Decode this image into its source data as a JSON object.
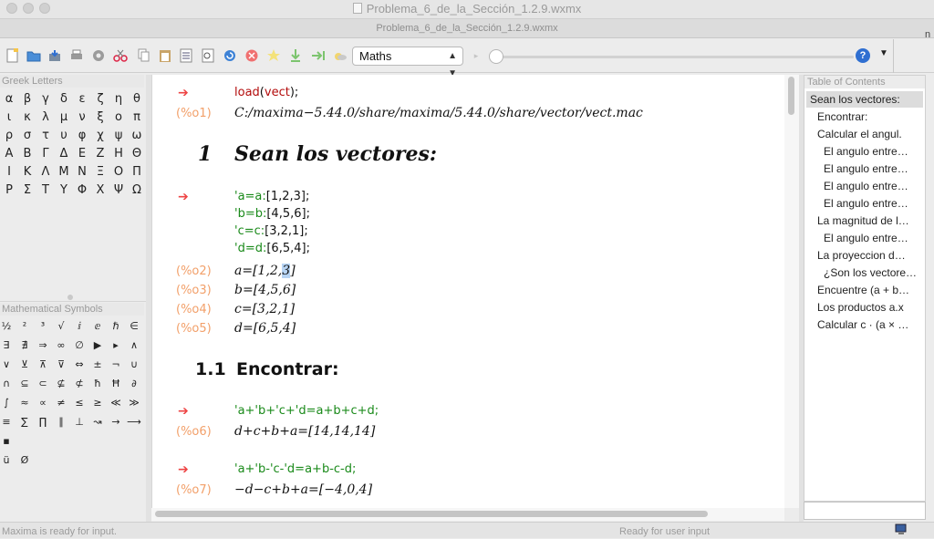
{
  "window": {
    "title": "Problema_6_de_la_Sección_1.2.9.wxmx",
    "tab_title": "Problema_6_de_la_Sección_1.2.9.wxmx",
    "edge_letter": "n"
  },
  "toolbar": {
    "icons": [
      "new-file-icon",
      "open-folder-icon",
      "save-icon",
      "print-icon",
      "settings-icon",
      "cut-icon",
      "copy-icon",
      "paste-icon",
      "select-all-icon",
      "find-icon",
      "refresh-icon",
      "stop-icon",
      "star-icon",
      "download-icon",
      "step-icon",
      "cloud-icon"
    ],
    "mode_select": "Maths",
    "help_label": "?"
  },
  "greek_panel": {
    "title": "Greek Letters",
    "rows": [
      [
        "α",
        "β",
        "γ",
        "δ",
        "ε",
        "ζ",
        "η",
        "θ"
      ],
      [
        "ι",
        "κ",
        "λ",
        "μ",
        "ν",
        "ξ",
        "ο",
        "π"
      ],
      [
        "ρ",
        "σ",
        "τ",
        "υ",
        "φ",
        "χ",
        "ψ",
        "ω"
      ],
      [
        "Α",
        "Β",
        "Γ",
        "Δ",
        "Ε",
        "Ζ",
        "Η",
        "Θ"
      ],
      [
        "Ι",
        "Κ",
        "Λ",
        "Μ",
        "Ν",
        "Ξ",
        "Ο",
        "Π"
      ],
      [
        "Ρ",
        "Σ",
        "Τ",
        "Υ",
        "Φ",
        "Χ",
        "Ψ",
        "Ω"
      ]
    ]
  },
  "symbols_panel": {
    "title": "Mathematical Symbols",
    "rows": [
      [
        "½",
        "²",
        "³",
        "√",
        "ⅈ",
        "ⅇ",
        "ℏ",
        "∈"
      ],
      [
        "∃",
        "∄",
        "⇒",
        "∞",
        "∅",
        "▶",
        "▸",
        "∧"
      ],
      [
        "∨",
        "⊻",
        "⊼",
        "⊽",
        "⇔",
        "±",
        "¬",
        "∪"
      ],
      [
        "∩",
        "⊆",
        "⊂",
        "⊈",
        "⊄",
        "ħ",
        "Ħ",
        "∂"
      ],
      [
        "∫",
        "≈",
        "∝",
        "≠",
        "≤",
        "≥",
        "≪",
        "≫"
      ],
      [
        "≡",
        "∑",
        "∏",
        "∥",
        "⊥",
        "↝",
        "→",
        "⟶"
      ],
      [
        "▪"
      ],
      [
        "ü",
        "Ø"
      ]
    ]
  },
  "document": {
    "cells": [
      {
        "type": "input",
        "segments": [
          {
            "t": "load",
            "c": "fn"
          },
          {
            "t": "(",
            "c": "txt"
          },
          {
            "t": "vect",
            "c": "fn"
          },
          {
            "t": ");",
            "c": "txt"
          }
        ]
      },
      {
        "type": "output",
        "label": "(%o1)",
        "text": "C:/maxima−5.44.0/share/maxima/5.44.0/share/vector/vect.mac"
      },
      {
        "type": "section",
        "number": "1",
        "title": "Sean los vectores:"
      },
      {
        "type": "input_multi",
        "lines": [
          [
            {
              "t": "'a=a:",
              "c": "var"
            },
            {
              "t": "[1,2,3];",
              "c": "txt"
            }
          ],
          [
            {
              "t": "'b=b:",
              "c": "var"
            },
            {
              "t": "[4,5,6];",
              "c": "txt"
            }
          ],
          [
            {
              "t": "'c=c:",
              "c": "var"
            },
            {
              "t": "[3,2,1];",
              "c": "txt"
            }
          ],
          [
            {
              "t": "'d=d:",
              "c": "var"
            },
            {
              "t": "[6,5,4];",
              "c": "txt"
            }
          ]
        ]
      },
      {
        "type": "output",
        "label": "(%o2)",
        "text": "a=[1,2,",
        "highlight": "3",
        "after": "]"
      },
      {
        "type": "output",
        "label": "(%o3)",
        "text": "b=[4,5,6]"
      },
      {
        "type": "output",
        "label": "(%o4)",
        "text": "c=[3,2,1]"
      },
      {
        "type": "output",
        "label": "(%o5)",
        "text": "d=[6,5,4]"
      },
      {
        "type": "subsection",
        "number": "1.1",
        "title": "Encontrar:"
      },
      {
        "type": "input",
        "segments": [
          {
            "t": "'a+'b+'c+'d=a+b+c+d;",
            "c": "var"
          }
        ]
      },
      {
        "type": "output",
        "label": "(%o6)",
        "text": "d+c+b+a=[14,14,14]"
      },
      {
        "type": "input",
        "segments": [
          {
            "t": "'a+'b-'c-'d=a+b-c-d;",
            "c": "var"
          }
        ]
      },
      {
        "type": "output",
        "label": "(%o7)",
        "text": "−d−c+b+a=[−4,0,4]"
      }
    ]
  },
  "toc": {
    "title": "Table of Contents",
    "items": [
      {
        "label": "Sean los vectores:",
        "level": 0,
        "selected": true
      },
      {
        "label": "Encontrar:",
        "level": 1
      },
      {
        "label": "Calcular el angul.",
        "level": 1
      },
      {
        "label": "El angulo entre…",
        "level": 2
      },
      {
        "label": "El angulo entre…",
        "level": 2
      },
      {
        "label": "El angulo entre…",
        "level": 2
      },
      {
        "label": "El angulo entre…",
        "level": 2
      },
      {
        "label": "La magnitud de l…",
        "level": 1
      },
      {
        "label": "El angulo entre…",
        "level": 2
      },
      {
        "label": "La proyeccion d…",
        "level": 1
      },
      {
        "label": "¿Son los vectore…",
        "level": 2
      },
      {
        "label": "Encuentre (a + b…",
        "level": 1
      },
      {
        "label": "Los productos a.x",
        "level": 1
      },
      {
        "label": "Calcular c · (a × …",
        "level": 1
      }
    ]
  },
  "status": {
    "left": "Maxima is ready for input.",
    "middle": "Ready for user input"
  }
}
